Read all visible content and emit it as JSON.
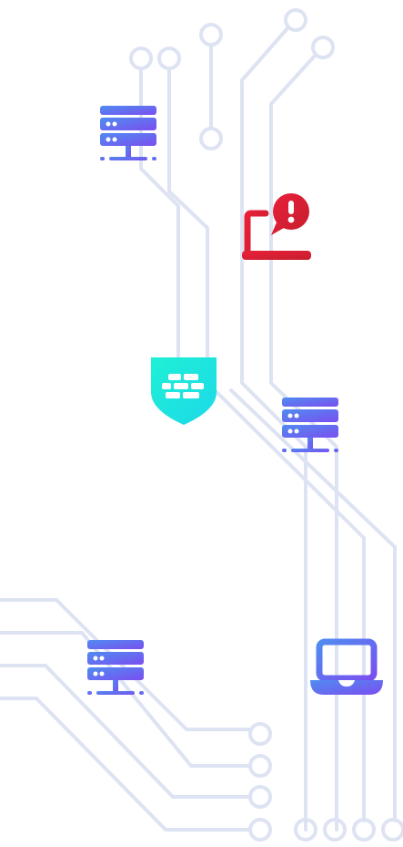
{
  "theme": {
    "circuit_line": "#dde3f2",
    "server_gradient": [
      "#4f8cf0",
      "#7a4ff0"
    ],
    "laptop_gradient": [
      "#4f8cf0",
      "#7a4ff0"
    ],
    "alert_gradient": [
      "#e8203a",
      "#c81e2e"
    ],
    "firewall_gradient": [
      "#1ff0d6",
      "#1cd9e8"
    ]
  },
  "icons": [
    {
      "name": "server-icon",
      "role": "server"
    },
    {
      "name": "laptop-alert-icon",
      "role": "compromised-endpoint"
    },
    {
      "name": "firewall-shield-icon",
      "role": "firewall"
    },
    {
      "name": "server-icon",
      "role": "server"
    },
    {
      "name": "server-icon",
      "role": "server"
    },
    {
      "name": "laptop-icon",
      "role": "endpoint"
    }
  ]
}
